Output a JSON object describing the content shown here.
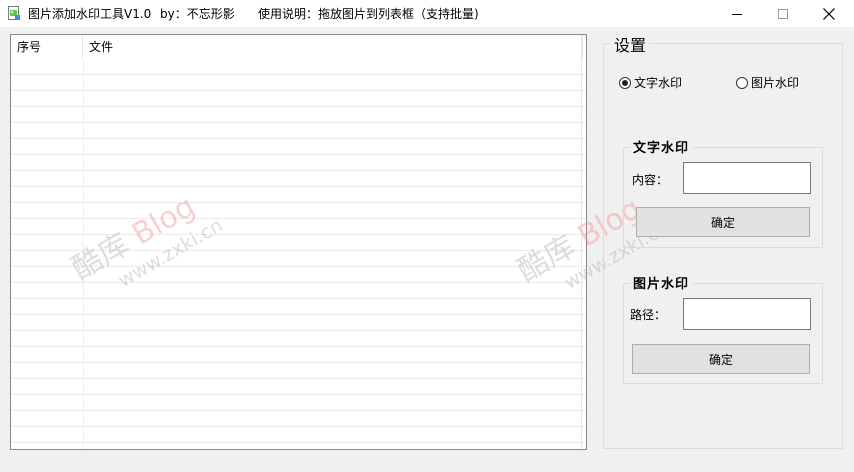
{
  "window": {
    "title": "图片添加水印工具V1.0",
    "author": "by：不忘形影",
    "instructions": "使用说明：拖放图片到列表框（支持批量)"
  },
  "list": {
    "columns": [
      "序号",
      "文件"
    ]
  },
  "watermark_overlay": {
    "brand": "酷库",
    "blog": "Blog",
    "url": "www.zxki.cn"
  },
  "settings": {
    "title": "设置",
    "radio_text": "文字水印",
    "radio_image": "图片水印",
    "selected": "文字水印",
    "text_group": {
      "title": "文字水印",
      "label": "内容：",
      "value": "",
      "button": "确定"
    },
    "image_group": {
      "title": "图片水印",
      "label": "路径：",
      "value": "",
      "button": "确定"
    }
  },
  "colors": {
    "window_bg": "#f0f0f0",
    "titlebar_bg": "#ffffff",
    "button_bg": "#e1e1e1",
    "watermark_pink": "#f09696"
  }
}
